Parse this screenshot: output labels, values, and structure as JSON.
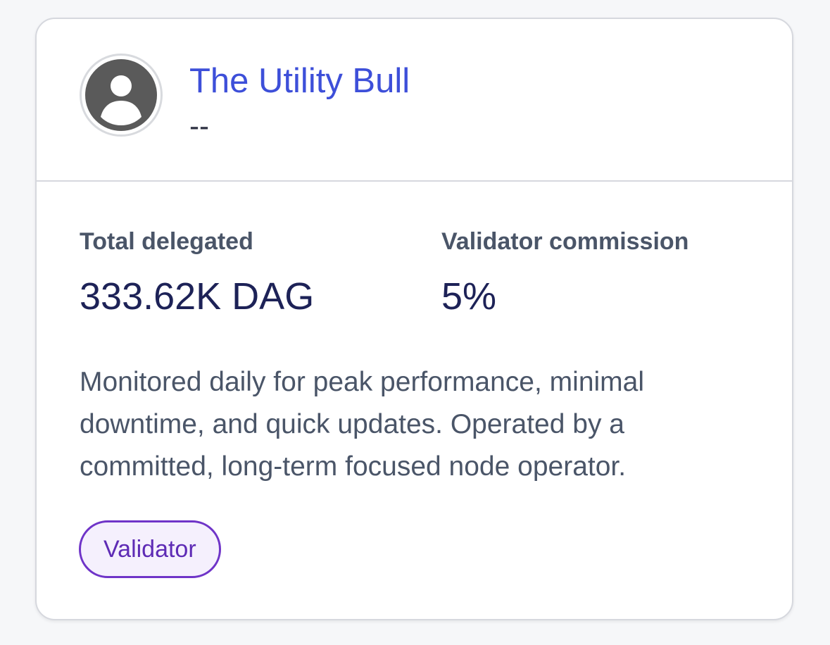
{
  "validator": {
    "name": "The Utility Bull",
    "subtitle": "--",
    "avatar_icon": "user-avatar-icon"
  },
  "stats": {
    "total_delegated_label": "Total delegated",
    "total_delegated_value": "333.62K DAG",
    "commission_label": "Validator commission",
    "commission_value": "5%"
  },
  "description": "Monitored daily for peak performance, minimal downtime, and quick updates. Operated by a committed, long-term focused node operator.",
  "badge": {
    "label": "Validator"
  },
  "colors": {
    "name_link": "#3d4fd9",
    "value_text": "#1d2257",
    "badge_border": "#6f34c8",
    "badge_background": "#f5f0fd",
    "card_border": "#d6d8de"
  }
}
